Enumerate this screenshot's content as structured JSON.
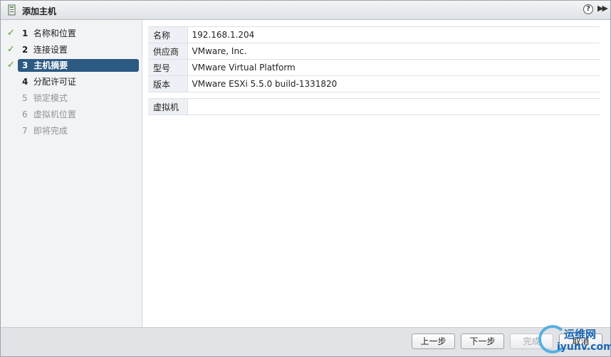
{
  "dialog": {
    "title": "添加主机",
    "help_label": "?",
    "expand_label": "▶▶"
  },
  "steps": [
    {
      "num": "1",
      "label": "名称和位置",
      "state": "done"
    },
    {
      "num": "2",
      "label": "连接设置",
      "state": "done"
    },
    {
      "num": "3",
      "label": "主机摘要",
      "state": "current"
    },
    {
      "num": "4",
      "label": "分配许可证",
      "state": "todo"
    },
    {
      "num": "5",
      "label": "锁定模式",
      "state": "disabled"
    },
    {
      "num": "6",
      "label": "虚拟机位置",
      "state": "disabled"
    },
    {
      "num": "7",
      "label": "即将完成",
      "state": "disabled"
    }
  ],
  "summary": {
    "rows": [
      {
        "key": "名称",
        "value": "192.168.1.204"
      },
      {
        "key": "供应商",
        "value": "VMware, Inc."
      },
      {
        "key": "型号",
        "value": "VMware Virtual Platform"
      },
      {
        "key": "版本",
        "value": "VMware ESXi 5.5.0 build-1331820"
      }
    ],
    "vm_key": "虚拟机",
    "vm_value": ""
  },
  "footer": {
    "back_label": "上一步",
    "next_label": "下一步",
    "finish_label": "完成",
    "cancel_label": "取消"
  },
  "watermark": {
    "line1": "运维网",
    "line2": "iyunv.com"
  },
  "colors": {
    "current_step_bg": "#2b5a83",
    "check_color": "#4aa02c",
    "key_cell_bg": "#edf1f5"
  }
}
